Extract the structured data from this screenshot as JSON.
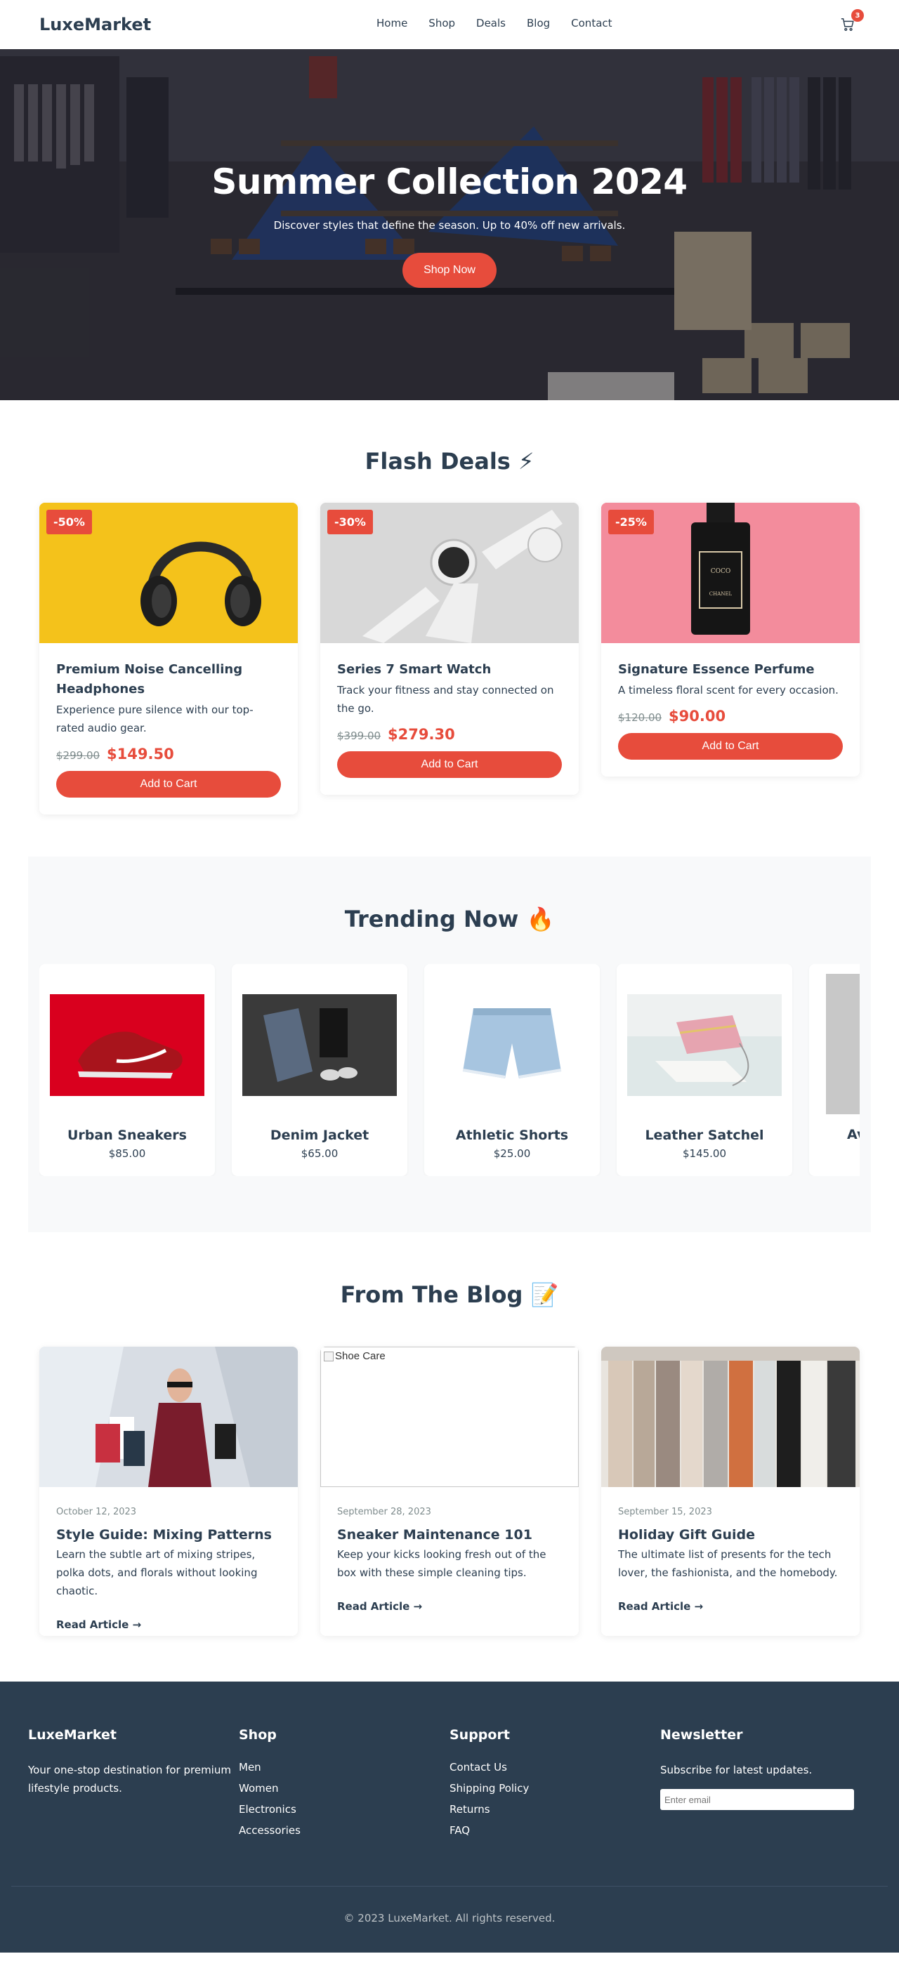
{
  "header": {
    "logo": "LuxeMarket",
    "nav": [
      "Home",
      "Shop",
      "Deals",
      "Blog",
      "Contact"
    ],
    "cart_count": "3"
  },
  "hero": {
    "title": "Summer Collection 2024",
    "subtitle": "Discover styles that define the season. Up to 40% off new arrivals.",
    "cta": "Shop Now"
  },
  "flash_deals": {
    "title": "Flash Deals ⚡",
    "items": [
      {
        "badge": "-50%",
        "name": "Premium Noise Cancelling Headphones",
        "desc": "Experience pure silence with our top-rated audio gear.",
        "old_price": "$299.00",
        "new_price": "$149.50",
        "button": "Add to Cart"
      },
      {
        "badge": "-30%",
        "name": "Series 7 Smart Watch",
        "desc": "Track your fitness and stay connected on the go.",
        "old_price": "$399.00",
        "new_price": "$279.30",
        "button": "Add to Cart"
      },
      {
        "badge": "-25%",
        "name": "Signature Essence Perfume",
        "desc": "A timeless floral scent for every occasion.",
        "old_price": "$120.00",
        "new_price": "$90.00",
        "button": "Add to Cart"
      }
    ]
  },
  "trending": {
    "title": "Trending Now 🔥",
    "items": [
      {
        "name": "Urban Sneakers",
        "price": "$85.00"
      },
      {
        "name": "Denim Jacket",
        "price": "$65.00"
      },
      {
        "name": "Athletic Shorts",
        "price": "$25.00"
      },
      {
        "name": "Leather Satchel",
        "price": "$145.00"
      },
      {
        "name": "Av",
        "price": ""
      }
    ]
  },
  "blog": {
    "title": "From The Blog 📝",
    "posts": [
      {
        "date": "October 12, 2023",
        "title": "Style Guide: Mixing Patterns",
        "excerpt": "Learn the subtle art of mixing stripes, polka dots, and florals without looking chaotic.",
        "link": "Read Article →"
      },
      {
        "date": "September 28, 2023",
        "title": "Sneaker Maintenance 101",
        "excerpt": "Keep your kicks looking fresh out of the box with these simple cleaning tips.",
        "link": "Read Article →",
        "broken_alt": "Shoe Care"
      },
      {
        "date": "September 15, 2023",
        "title": "Holiday Gift Guide",
        "excerpt": "The ultimate list of presents for the tech lover, the fashionista, and the homebody.",
        "link": "Read Article →"
      }
    ]
  },
  "footer": {
    "brand": "LuxeMarket",
    "brand_desc": "Your one-stop destination for premium lifestyle products.",
    "shop_title": "Shop",
    "shop_links": [
      "Men",
      "Women",
      "Electronics",
      "Accessories"
    ],
    "support_title": "Support",
    "support_links": [
      "Contact Us",
      "Shipping Policy",
      "Returns",
      "FAQ"
    ],
    "newsletter_title": "Newsletter",
    "newsletter_desc": "Subscribe for latest updates.",
    "newsletter_placeholder": "Enter email",
    "copyright": "© 2023 LuxeMarket. All rights reserved."
  },
  "colors": {
    "accent": "#e74c3c",
    "primary": "#2c3e50",
    "footer_bg": "#2c3e50",
    "section_bg": "#f8f9fa"
  }
}
